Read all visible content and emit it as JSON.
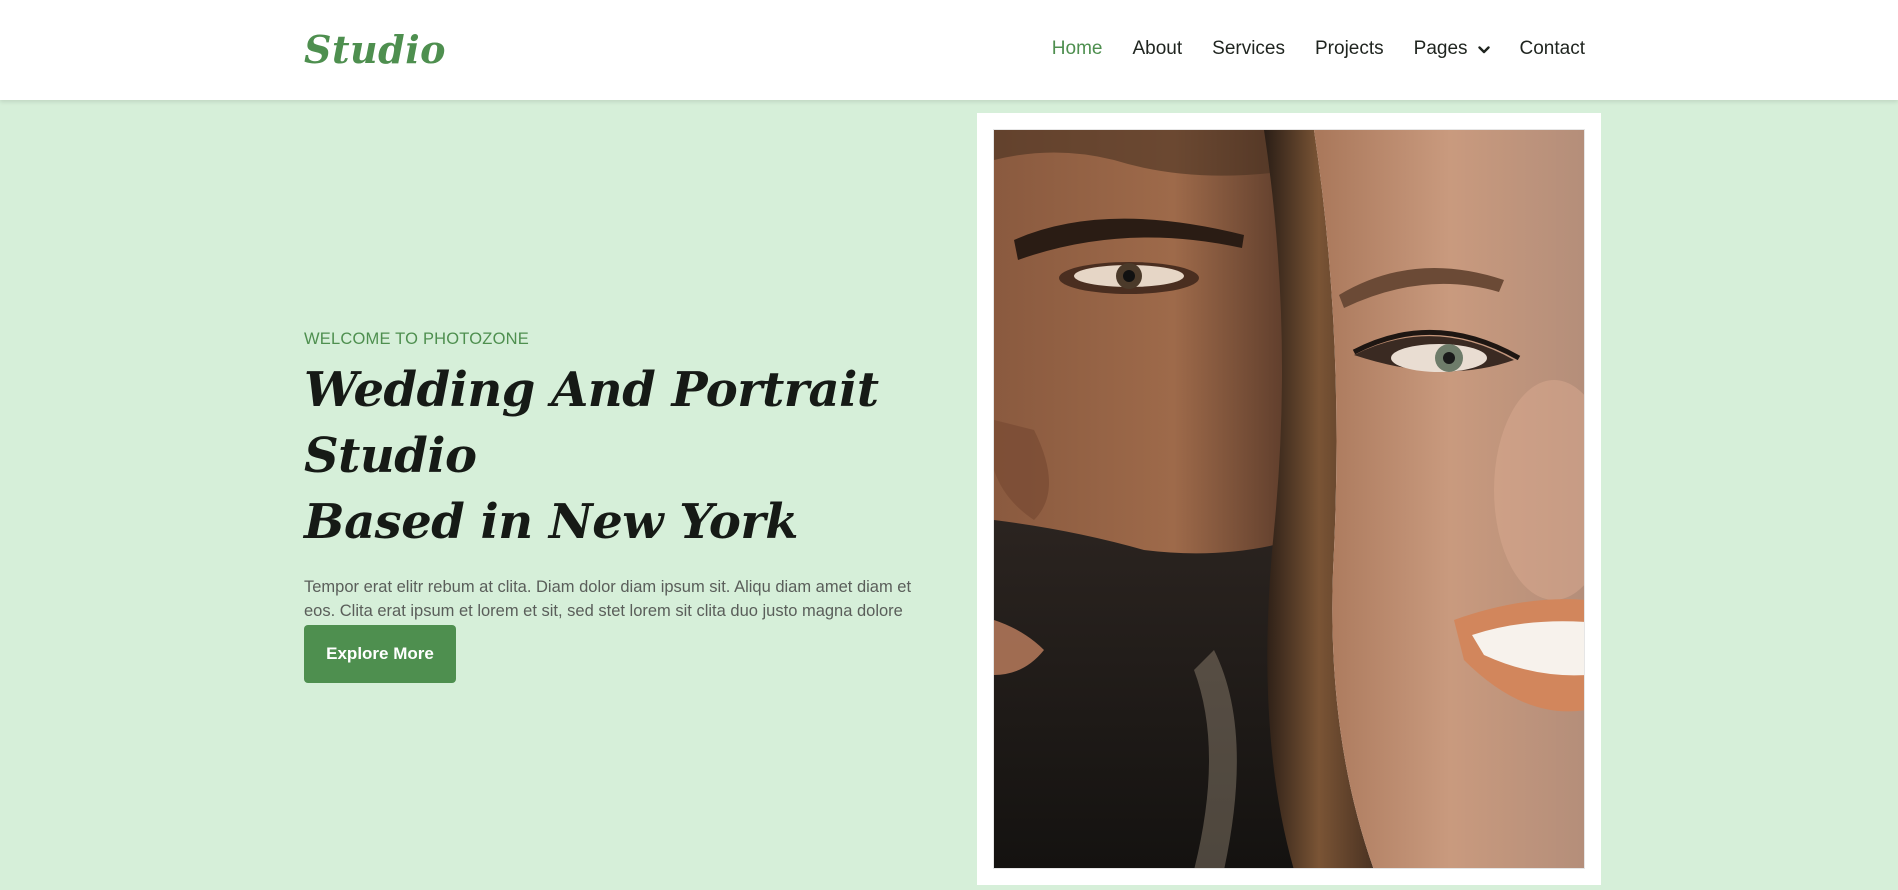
{
  "brand": {
    "name": "Studio",
    "color": "#4e8f4f"
  },
  "nav": {
    "items": [
      {
        "label": "Home",
        "active": true
      },
      {
        "label": "About",
        "active": false
      },
      {
        "label": "Services",
        "active": false
      },
      {
        "label": "Projects",
        "active": false
      },
      {
        "label": "Pages",
        "active": false,
        "has_dropdown": true,
        "icon": "chevron-down-icon"
      },
      {
        "label": "Contact",
        "active": false
      }
    ]
  },
  "hero": {
    "eyebrow": "WELCOME TO PHOTOZONE",
    "headline_line1": "Wedding And Portrait Studio",
    "headline_line2": "Based in New York",
    "lead": "Tempor erat elitr rebum at clita. Diam dolor diam ipsum sit. Aliqu diam amet diam et eos. Clita erat ipsum et lorem et sit, sed stet lorem sit clita duo justo magna dolore erat amet",
    "cta_label": "Explore More"
  },
  "colors": {
    "accent": "#4e8f4f",
    "hero_background": "#d6efd9",
    "heading": "#161a16",
    "body_text": "#5a5e5a"
  }
}
